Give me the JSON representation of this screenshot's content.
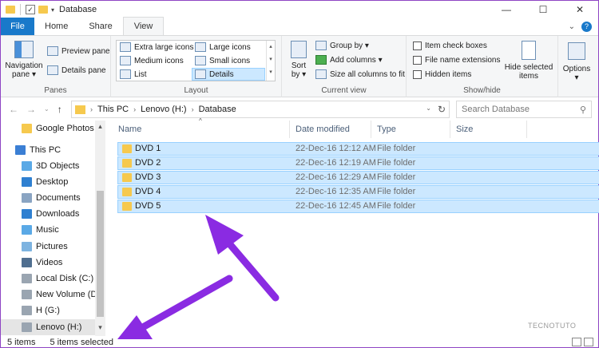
{
  "window": {
    "title": "Database",
    "controls": {
      "minimize": "—",
      "maximize": "☐",
      "close": "✕"
    }
  },
  "ribbon": {
    "tabs": [
      "File",
      "Home",
      "Share",
      "View"
    ],
    "active_tab": "View",
    "panes": {
      "navigation_pane": "Navigation pane ▾",
      "preview_pane": "Preview pane",
      "details_pane": "Details pane",
      "label": "Panes"
    },
    "layout": {
      "options": [
        "Extra large icons",
        "Large icons",
        "Medium icons",
        "Small icons",
        "List",
        "Details"
      ],
      "selected": "Details",
      "label": "Layout"
    },
    "current_view": {
      "sort_by": "Sort by ▾",
      "group_by": "Group by ▾",
      "add_columns": "Add columns ▾",
      "size_all_columns": "Size all columns to fit",
      "label": "Current view"
    },
    "show_hide": {
      "item_check_boxes": "Item check boxes",
      "file_name_extensions": "File name extensions",
      "hidden_items": "Hidden items",
      "hide_selected_items": "Hide selected items",
      "label": "Show/hide"
    },
    "options": "Options ▾"
  },
  "address": {
    "crumbs": [
      "This PC",
      "Lenovo (H:)",
      "Database"
    ],
    "search_placeholder": "Search Database"
  },
  "navpane": {
    "items": [
      {
        "label": "Google Photos",
        "icon": "google-photos-icon",
        "color": "#f6c94e",
        "indent": 1
      },
      {
        "label": "This PC",
        "icon": "pc-icon",
        "color": "#3b7fd4",
        "indent": 0
      },
      {
        "label": "3D Objects",
        "icon": "3d-objects-icon",
        "color": "#5aa9e6",
        "indent": 1
      },
      {
        "label": "Desktop",
        "icon": "desktop-icon",
        "color": "#2f80d1",
        "indent": 1
      },
      {
        "label": "Documents",
        "icon": "documents-icon",
        "color": "#8aa4c2",
        "indent": 1
      },
      {
        "label": "Downloads",
        "icon": "downloads-icon",
        "color": "#2f80d1",
        "indent": 1
      },
      {
        "label": "Music",
        "icon": "music-icon",
        "color": "#5aa9e6",
        "indent": 1
      },
      {
        "label": "Pictures",
        "icon": "pictures-icon",
        "color": "#7db3e0",
        "indent": 1
      },
      {
        "label": "Videos",
        "icon": "videos-icon",
        "color": "#4f6e8f",
        "indent": 1
      },
      {
        "label": "Local Disk (C:)",
        "icon": "drive-icon",
        "color": "#9aa5b1",
        "indent": 1
      },
      {
        "label": "New Volume (D:",
        "icon": "drive-icon",
        "color": "#9aa5b1",
        "indent": 1
      },
      {
        "label": "H (G:)",
        "icon": "drive-icon",
        "color": "#9aa5b1",
        "indent": 1
      },
      {
        "label": "Lenovo (H:)",
        "icon": "drive-icon",
        "color": "#9aa5b1",
        "indent": 1,
        "selected": true
      }
    ]
  },
  "files": {
    "columns": [
      "Name",
      "Date modified",
      "Type",
      "Size"
    ],
    "rows": [
      {
        "name": "DVD 1",
        "date": "22-Dec-16 12:12 AM",
        "type": "File folder",
        "size": ""
      },
      {
        "name": "DVD 2",
        "date": "22-Dec-16 12:19 AM",
        "type": "File folder",
        "size": ""
      },
      {
        "name": "DVD 3",
        "date": "22-Dec-16 12:29 AM",
        "type": "File folder",
        "size": ""
      },
      {
        "name": "DVD 4",
        "date": "22-Dec-16 12:35 AM",
        "type": "File folder",
        "size": ""
      },
      {
        "name": "DVD 5",
        "date": "22-Dec-16 12:45 AM",
        "type": "File folder",
        "size": ""
      }
    ]
  },
  "status": {
    "item_count": "5 items",
    "selected_count": "5 items selected"
  },
  "watermark": "TECNOTUTO",
  "colors": {
    "accent": "#1979ca",
    "selection": "#cce8ff",
    "arrow": "#8a2be2"
  }
}
